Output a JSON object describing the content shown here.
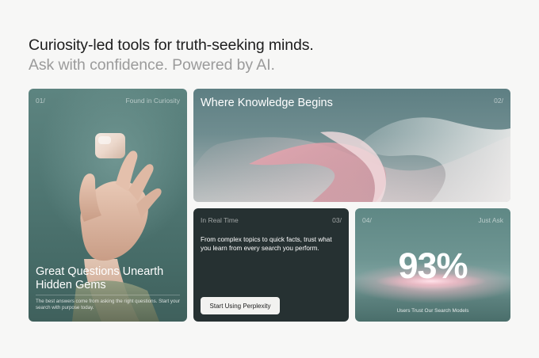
{
  "hero": {
    "headline": "Curiosity-led tools for truth-seeking minds.",
    "subline": "Ask with confidence. Powered by AI."
  },
  "cards": [
    {
      "num": "01/",
      "tag": "Found in Curiosity",
      "title": "Great Questions Unearth Hidden Gems",
      "body": "The best answers come from asking the right questions. Start your search with purpose today."
    },
    {
      "num": "02/",
      "title": "Where Knowledge Begins"
    },
    {
      "num": "03/",
      "tag": "In Real Time",
      "body": "From complex topics to quick facts, trust what you learn from every search you perform.",
      "cta": "Start Using Perplexity"
    },
    {
      "num": "04/",
      "tag": "Just Ask",
      "stat": "93%",
      "caption": "Users Trust Our Search Models"
    }
  ],
  "colors": {
    "page_bg": "#f7f7f6",
    "teal": "#4f7672",
    "dark_card": "#263132",
    "accent_pink": "#f0c4cd"
  },
  "icons": [
    "glass-cube-icon",
    "hand-illustration",
    "silk-ribbon-illustration",
    "pink-glow-illustration"
  ]
}
